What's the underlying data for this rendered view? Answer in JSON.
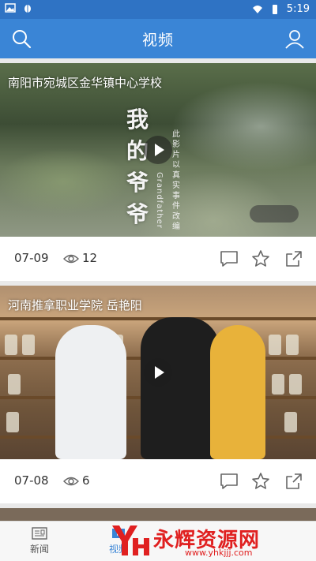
{
  "status_bar": {
    "time": "5:19",
    "icons": [
      "image-icon",
      "bug-icon",
      "wifi-icon",
      "battery-icon"
    ]
  },
  "app_bar": {
    "title": "视频",
    "icons": [
      "search-icon",
      "user-icon"
    ]
  },
  "videos": [
    {
      "overlay_title": "南阳市宛城区金华镇中心学校",
      "poster_title": "我的爷爷",
      "poster_subtitle": "此影片以真实事件改编",
      "poster_english": "Grandfather",
      "date": "07-09",
      "views": "12"
    },
    {
      "overlay_title": "河南推拿职业学院 岳艳阳",
      "date": "07-08",
      "views": "6"
    }
  ],
  "tabs": [
    {
      "label": "新闻",
      "icon": "news-icon"
    },
    {
      "label": "视频",
      "icon": "video-icon",
      "active": true
    }
  ],
  "watermark": {
    "text": "永辉资源网",
    "url": "www.yhkjjj.com"
  },
  "colors": {
    "status_bar": "#2f73c4",
    "app_bar": "#3a85d6",
    "active_tab": "#3a85d6",
    "watermark": "#e02020"
  }
}
